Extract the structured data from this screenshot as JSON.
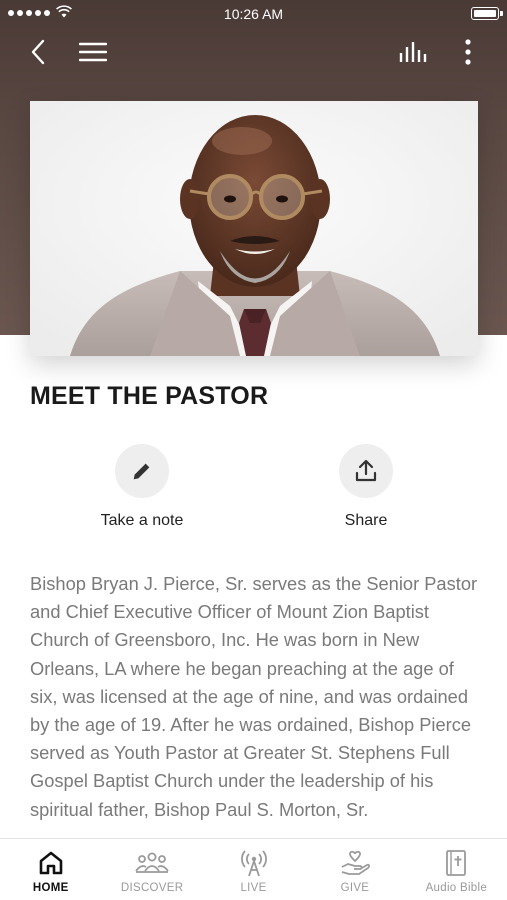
{
  "status_bar": {
    "time": "10:26 AM"
  },
  "nav": {
    "back_icon": "chevron-left-icon",
    "menu_icon": "hamburger-menu-icon",
    "stats_icon": "bar-chart-icon",
    "more_icon": "more-vertical-icon"
  },
  "hero": {
    "image": "pastor-portrait"
  },
  "page": {
    "title": "MEET THE PASTOR"
  },
  "actions": [
    {
      "label": "Take a note",
      "icon": "pencil-icon"
    },
    {
      "label": "Share",
      "icon": "share-icon"
    }
  ],
  "bio": {
    "text": "Bishop Bryan J. Pierce, Sr. serves as the Senior Pastor and Chief Executive Officer of Mount Zion Baptist Church of Greensboro, Inc. He was born in New Orleans, LA where he began preaching at the age of six, was licensed at the age of nine, and was ordained by the age of 19. After he was ordained, Bishop Pierce served as Youth Pastor at Greater St. Stephens Full Gospel Baptist Church under the leadership of his spiritual father, Bishop Paul S. Morton, Sr."
  },
  "tabs": [
    {
      "label": "HOME",
      "icon": "home-icon",
      "active": true
    },
    {
      "label": "DISCOVER",
      "icon": "people-icon",
      "active": false
    },
    {
      "label": "LIVE",
      "icon": "broadcast-icon",
      "active": false
    },
    {
      "label": "GIVE",
      "icon": "giving-hand-icon",
      "active": false
    },
    {
      "label": "Audio Bible",
      "icon": "bible-icon",
      "active": false
    }
  ],
  "colors": {
    "header_bg": "#5a4843",
    "active_tab": "#111111",
    "inactive_tab": "#9a9a9a"
  }
}
